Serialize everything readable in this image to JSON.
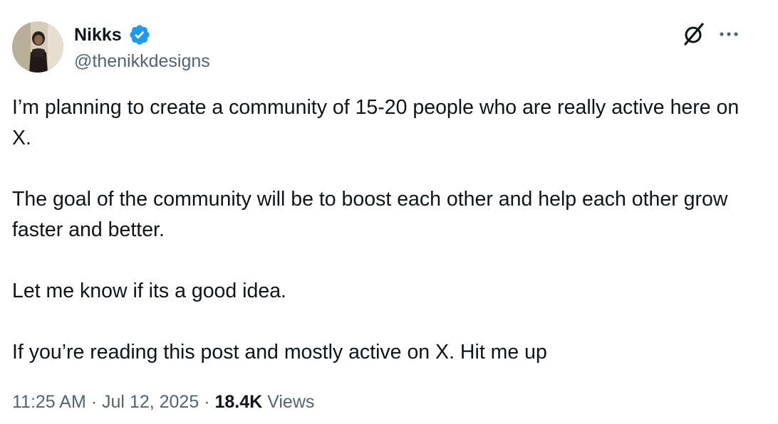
{
  "author": {
    "name": "Nikks",
    "handle": "@thenikkdesigns",
    "verified": true
  },
  "icons": {
    "verified": "verified-badge-icon",
    "grok": "grok-icon",
    "more": "more-options-icon"
  },
  "colors": {
    "verified_blue": "#1d9bf0",
    "text_primary": "#0f1419",
    "text_secondary": "#536471"
  },
  "post": {
    "paragraphs": [
      "I’m planning to create a community of 15-20 people who are really active here on X.",
      "The goal of the community will be to boost each other and help each other grow faster and better.",
      "Let me know if its a good idea.",
      "If you’re reading this post and mostly active on X. Hit me up"
    ]
  },
  "meta": {
    "time": "11:25 AM",
    "separator": "·",
    "date": "Jul 12, 2025",
    "views_count": "18.4K",
    "views_label": "Views"
  }
}
